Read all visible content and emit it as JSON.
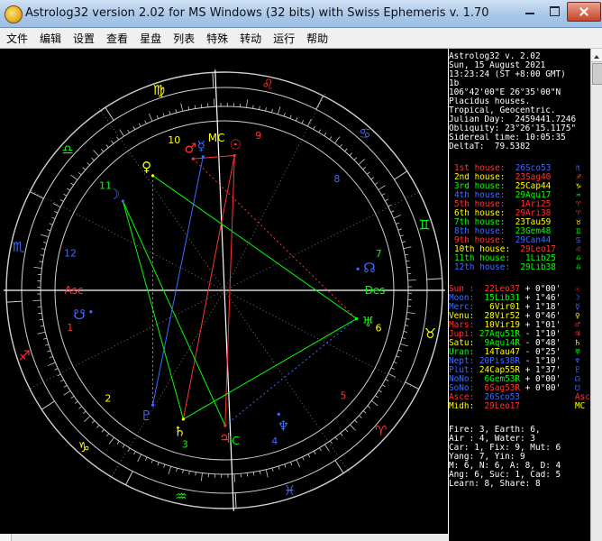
{
  "window": {
    "title": "Astrolog32 version 2.02 for MS Windows (32 bits) with Swiss Ephemeris v. 1.70"
  },
  "menu": [
    "文件",
    "编辑",
    "设置",
    "查看",
    "星盘",
    "列表",
    "特殊",
    "转动",
    "运行",
    "帮助"
  ],
  "colors": {
    "background": "#000000",
    "sign_ring": "#cfcfcf",
    "house_ring": "#cfcfcf",
    "fire": "#ff3333",
    "earth": "#ffff00",
    "air": "#00ff00",
    "water": "#3f6bff"
  },
  "wheel": {
    "signs": [
      {
        "name": "Aries",
        "glyph": "♈",
        "color": "#ff3333"
      },
      {
        "name": "Taurus",
        "glyph": "♉",
        "color": "#ffff00"
      },
      {
        "name": "Gemini",
        "glyph": "♊",
        "color": "#00ff00"
      },
      {
        "name": "Cancer",
        "glyph": "♋",
        "color": "#3f6bff"
      },
      {
        "name": "Leo",
        "glyph": "♌",
        "color": "#ff3333"
      },
      {
        "name": "Virgo",
        "glyph": "♍",
        "color": "#ffff00"
      },
      {
        "name": "Libra",
        "glyph": "♎",
        "color": "#00ff00"
      },
      {
        "name": "Scorpio",
        "glyph": "♏",
        "color": "#3f6bff"
      },
      {
        "name": "Sagittarius",
        "glyph": "♐",
        "color": "#ff3333"
      },
      {
        "name": "Capricorn",
        "glyph": "♑",
        "color": "#ffff00"
      },
      {
        "name": "Aquarius",
        "glyph": "♒",
        "color": "#00ff00"
      },
      {
        "name": "Pisces",
        "glyph": "♓",
        "color": "#3f6bff"
      }
    ],
    "houses": [
      {
        "num": "1",
        "color": "#ff3333"
      },
      {
        "num": "2",
        "color": "#ffff00"
      },
      {
        "num": "3",
        "color": "#00ff00"
      },
      {
        "num": "4",
        "color": "#3f6bff"
      },
      {
        "num": "5",
        "color": "#ff3333"
      },
      {
        "num": "6",
        "color": "#ffff00"
      },
      {
        "num": "7",
        "color": "#00ff00"
      },
      {
        "num": "8",
        "color": "#3f6bff"
      },
      {
        "num": "9",
        "color": "#ff3333"
      },
      {
        "num": "10",
        "color": "#ffff00"
      },
      {
        "num": "11",
        "color": "#00ff00"
      },
      {
        "num": "12",
        "color": "#3f6bff"
      }
    ],
    "asc_label": "Asc",
    "dsc_label": "Des",
    "mc_label": "MC",
    "ic_label": "IC",
    "planets": [
      {
        "name": "Sun",
        "glyph": "☉",
        "lon": 142.6,
        "color": "#ff3333"
      },
      {
        "name": "Moon",
        "glyph": "☽",
        "lon": 195.6,
        "color": "#3f6bff"
      },
      {
        "name": "Mercury",
        "glyph": "☿",
        "lon": 156.0,
        "color": "#3f6bff"
      },
      {
        "name": "Venus",
        "glyph": "♀",
        "lon": 178.9,
        "color": "#ffff00"
      },
      {
        "name": "Mars",
        "glyph": "♂",
        "lon": 160.3,
        "color": "#ff3333"
      },
      {
        "name": "Jupiter",
        "glyph": "♃",
        "lon": 327.2,
        "color": "#ff3333"
      },
      {
        "name": "Saturn",
        "glyph": "♄",
        "lon": 309.2,
        "color": "#ffff00"
      },
      {
        "name": "Uranus",
        "glyph": "♅",
        "lon": 44.8,
        "color": "#00ff00"
      },
      {
        "name": "Neptune",
        "glyph": "♆",
        "lon": 350.6,
        "color": "#3f6bff"
      },
      {
        "name": "Pluto",
        "glyph": "♇",
        "lon": 294.9,
        "color": "#3f6bff"
      },
      {
        "name": "North Node",
        "glyph": "☊",
        "lon": 66.0,
        "color": "#3f6bff"
      },
      {
        "name": "South Node",
        "glyph": "☋",
        "lon": 246.0,
        "color": "#3f6bff"
      }
    ]
  },
  "info": {
    "header": [
      "Astrolog32 v. 2.02",
      "Sun, 15 August 2021",
      "13:23:24 (ST +8:00 GMT)",
      "1b",
      "106°42'00\"E 26°35'00\"N",
      "Placidus houses.",
      "Tropical, Geocentric.",
      "Julian Day:  2459441.7246",
      "Obliquity: 23°26'15.1175\"",
      "Sidereal time: 10:05:35",
      "DeltaT:  79.5382"
    ],
    "houses": [
      {
        "label": "1st house:",
        "value": "26Sco53",
        "color": "#ff3333",
        "value_color": "#3f6bff",
        "glyph": "♏"
      },
      {
        "label": "2nd house:",
        "value": "23Sag40",
        "color": "#ffff00",
        "value_color": "#ff3333",
        "glyph": "♐"
      },
      {
        "label": "3rd house:",
        "value": "25Cap44",
        "color": "#00ff00",
        "value_color": "#ffff00",
        "glyph": "♑"
      },
      {
        "label": "4th house:",
        "value": "29Aqu17",
        "color": "#3f6bff",
        "value_color": "#00ff00",
        "glyph": "♒"
      },
      {
        "label": "5th house:",
        "value": "1Ari25",
        "color": "#ff3333",
        "value_color": "#ff3333",
        "glyph": "♈"
      },
      {
        "label": "6th house:",
        "value": "29Ari38",
        "color": "#ffff00",
        "value_color": "#ff3333",
        "glyph": "♈"
      },
      {
        "label": "7th house:",
        "value": "23Tau59",
        "color": "#00ff00",
        "value_color": "#ffff00",
        "glyph": "♉"
      },
      {
        "label": "8th house:",
        "value": "23Gem48",
        "color": "#3f6bff",
        "value_color": "#00ff00",
        "glyph": "♊"
      },
      {
        "label": "9th house:",
        "value": "29Can44",
        "color": "#ff3333",
        "value_color": "#3f6bff",
        "glyph": "♋"
      },
      {
        "label": "10th house:",
        "value": "29Leo17",
        "color": "#ffff00",
        "value_color": "#ff3333",
        "glyph": "♌"
      },
      {
        "label": "11th house:",
        "value": "1Lib25",
        "color": "#00ff00",
        "value_color": "#00ff00",
        "glyph": "♎"
      },
      {
        "label": "12th house:",
        "value": "29Lib38",
        "color": "#3f6bff",
        "value_color": "#00ff00",
        "glyph": "♎"
      }
    ],
    "planets": [
      {
        "label": "Sun :",
        "pos": "22Leo37",
        "lat": "+ 0°00'",
        "color": "#ff3333",
        "pos_color": "#ff3333",
        "glyph": "☉"
      },
      {
        "label": "Moon:",
        "pos": "15Lib31",
        "lat": "+ 1°46'",
        "color": "#3f6bff",
        "pos_color": "#00ff00",
        "glyph": "☽"
      },
      {
        "label": "Merc:",
        "pos": " 6Vir01",
        "lat": "+ 1°18'",
        "color": "#3f6bff",
        "pos_color": "#ffff00",
        "glyph": "☿"
      },
      {
        "label": "Venu:",
        "pos": "28Vir52",
        "lat": "+ 0°46'",
        "color": "#ffff00",
        "pos_color": "#ffff00",
        "glyph": "♀"
      },
      {
        "label": "Mars:",
        "pos": "10Vir19",
        "lat": "+ 1°01'",
        "color": "#ff3333",
        "pos_color": "#ffff00",
        "glyph": "♂"
      },
      {
        "label": "Jupi:",
        "pos": "27Aqu51R",
        "lat": "- 1°10'",
        "color": "#ff3333",
        "pos_color": "#00ff00",
        "glyph": "♃"
      },
      {
        "label": "Satu:",
        "pos": " 9Aqu14R",
        "lat": "- 0°48'",
        "color": "#ffff00",
        "pos_color": "#00ff00",
        "glyph": "♄"
      },
      {
        "label": "Uran:",
        "pos": "14Tau47",
        "lat": "- 0°25'",
        "color": "#00ff00",
        "pos_color": "#ffff00",
        "glyph": "♅"
      },
      {
        "label": "Nept:",
        "pos": "20Pis38R",
        "lat": "- 1°10'",
        "color": "#3f6bff",
        "pos_color": "#3f6bff",
        "glyph": "♆"
      },
      {
        "label": "Plut:",
        "pos": "24Cap55R",
        "lat": "+ 1°37'",
        "color": "#3f6bff",
        "pos_color": "#ffff00",
        "glyph": "♇"
      },
      {
        "label": "NoNo:",
        "pos": " 6Gem53R",
        "lat": "+ 0°00'",
        "color": "#3f6bff",
        "pos_color": "#00ff00",
        "glyph": "☊"
      },
      {
        "label": "SoNo:",
        "pos": " 6Sag53R",
        "lat": "+ 0°00'",
        "color": "#3f6bff",
        "pos_color": "#ff3333",
        "glyph": "☋"
      },
      {
        "label": "Asce:",
        "pos": "26Sco53",
        "lat": "",
        "color": "#ff3333",
        "pos_color": "#3f6bff",
        "glyph": "Asc"
      },
      {
        "label": "Midh:",
        "pos": "29Leo17",
        "lat": "",
        "color": "#ffff00",
        "pos_color": "#ff3333",
        "glyph": "MC"
      }
    ],
    "summary": [
      "Fire: 3, Earth: 6,",
      "Air : 4, Water: 3",
      "Car: 1, Fix: 9, Mut: 6",
      "Yang: 7, Yin: 9",
      "M: 6, N: 6, A: 8, D: 4",
      "Ang: 6, Suc: 1, Cad: 5",
      "Learn: 8, Share: 8"
    ]
  }
}
